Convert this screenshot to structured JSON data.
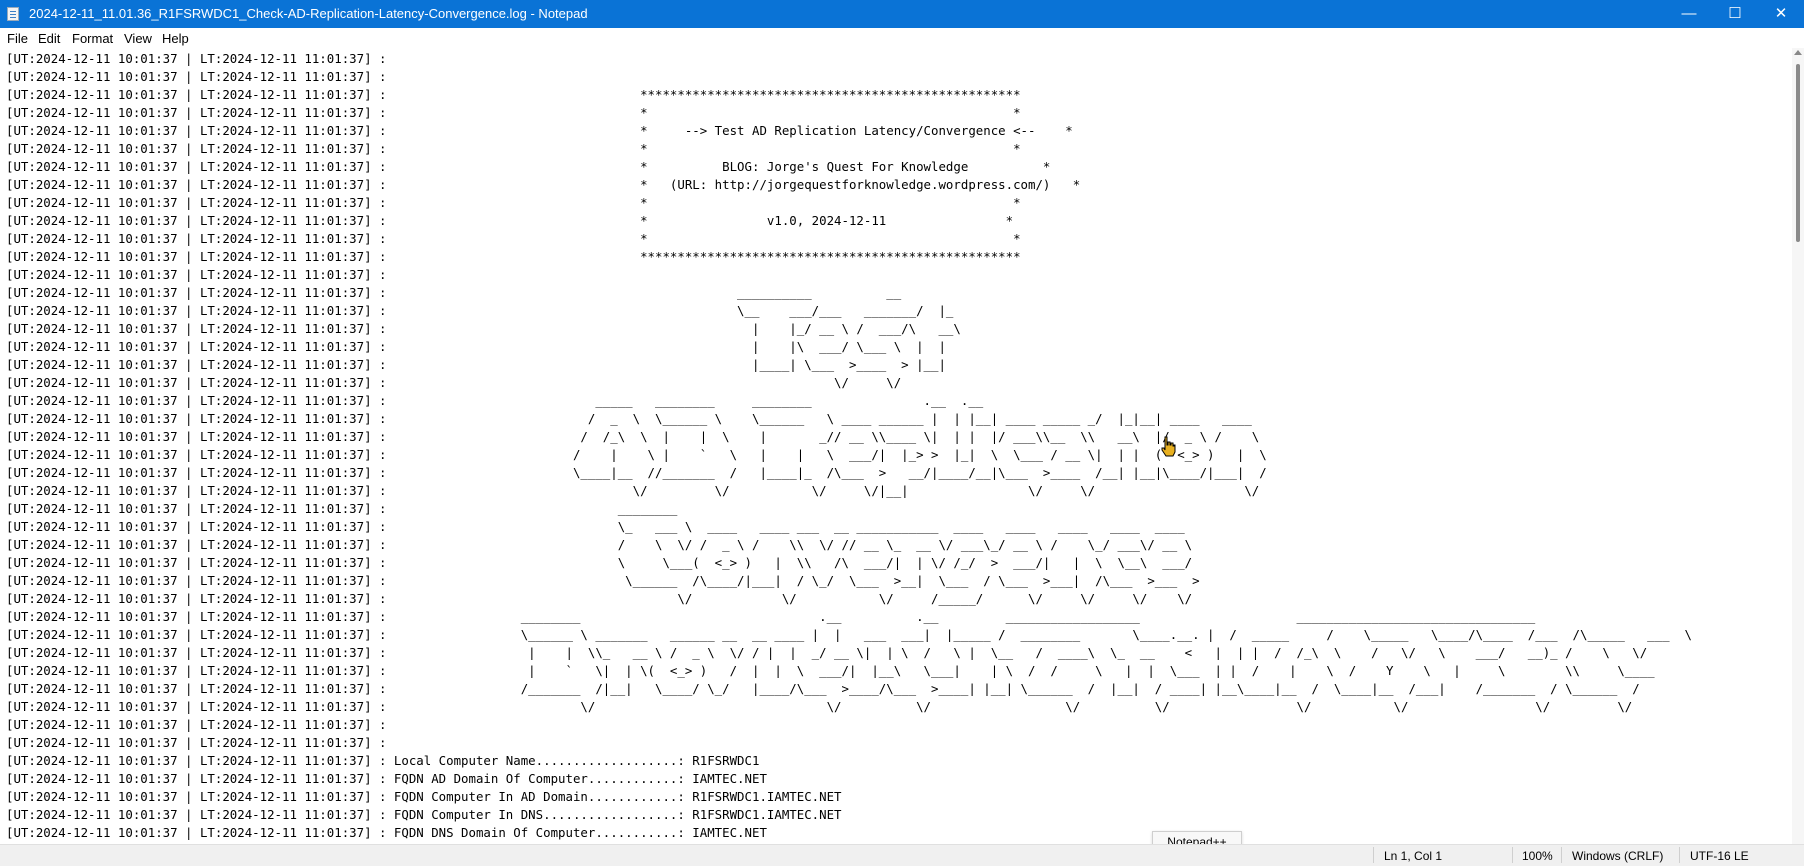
{
  "window": {
    "title": "2024-12-11_11.01.36_R1FSRWDC1_Check-AD-Replication-Latency-Convergence.log - Notepad",
    "minimize_glyph": "—",
    "maximize_glyph": "☐",
    "close_glyph": "✕"
  },
  "menu": [
    "File",
    "Edit",
    "Format",
    "View",
    "Help"
  ],
  "log": {
    "prefix": "[UT:2024-12-11 10:01:37 | LT:2024-12-11 11:01:37] : ",
    "lines": [
      "",
      "",
      "                                 ***************************************************",
      "                                 *                                                 *",
      "                                 *     --> Test AD Replication Latency/Convergence <--    *",
      "                                 *                                                 *",
      "                                 *          BLOG: Jorge's Quest For Knowledge          *",
      "                                 *   (URL: http://jorgequestforknowledge.wordpress.com/)   *",
      "                                 *                                                 *",
      "                                 *                v1.0, 2024-12-11                *",
      "                                 *                                                 *",
      "                                 ***************************************************",
      "",
      "                                              __________          __",
      "                                              \\__    ___/___   _______/  |_",
      "                                                |    |_/ __ \\ /  ___/\\   __\\",
      "                                                |    |\\  ___/ \\___ \\  |  |",
      "                                                |____| \\___  >____  > |__|",
      "                                                           \\/     \\/",
      "                           _____   ________     ________               .__  .__",
      "                          /  _  \\  \\______ \\    \\______   \\ ____ ______ |  | |__| ____ _____ _/  |_|__| ____   ____",
      "                         /  /_\\  \\  |    |  \\    |       _// __ \\\\____ \\|  | |  |/ ___\\\\__  \\\\   __\\  |/  _ \\ /    \\",
      "                        /    |    \\ |    `   \\   |    |   \\  ___/|  |_> >  |_|  \\  \\___ / __ \\|  | |  (  <_> )   |  \\",
      "                        \\____|__  //_______  /   |____|_  /\\___  >   __/|____/__|\\___  >____  /__| |__|\\____/|___|  /",
      "                                \\/         \\/           \\/     \\/|__|                \\/     \\/                    \\/",
      "                              ________",
      "                              \\_   ___ \\  ____   ____ ___  __ ___________  ____   ____   ____   ____  ____",
      "                              /    \\  \\/ /  _ \\ /    \\\\  \\/ // __ \\_  __ \\/ ___\\_/ __ \\ /    \\_/ ___\\/ __ \\",
      "                              \\     \\___(  <_> )   |  \\\\   /\\  ___/|  | \\/ /_/  >  ___/|   |  \\  \\__\\  ___/",
      "                               \\______  /\\____/|___|  / \\_/  \\___  >__|  \\___  / \\___  >___|  /\\___  >___  >",
      "                                      \\/            \\/           \\/     /_____/      \\/     \\/     \\/    \\/",
      "                 ________                                .__          .__         __________________                     ________________________________",
      "                 \\______ \\ _______   ______ __  __ ____ |  |   ___  ___|  |_____ /  ________       \\____.__. |  /  _____     /    \\_____   \\____/\\____  /___  /\\_____   ___  \\",
      "                  |    |  \\\\_   __ \\ /  _ \\  \\/ / |  |  _/ __ \\|  | \\  /   \\ |  \\__   /  ____\\  \\_  __    <   |  | |  /  /_\\  \\    /   \\/   \\    ___/   __)_ /    \\   \\/",
      "                  |    `   \\|  | \\(  <_> )   /  |  |  \\  ___/|  |__\\   \\___|    | \\  /  /     \\   |  |  \\___  | |  /    |    \\  /    Y    \\   |     \\        \\\\     \\____",
      "                 /_______  /|__|   \\____/ \\_/   |____/\\___  >____/\\___  >____| |__| \\______  /  |__|  / ____| |__\\____|__  /  \\____|__  /___|    /_______  / \\______  /",
      "                         \\/                               \\/          \\/                  \\/          \\/                 \\/           \\/                 \\/         \\/",
      "",
      "",
      "Local Computer Name...................: R1FSRWDC1",
      "FQDN AD Domain Of Computer............: IAMTEC.NET",
      "FQDN Computer In AD Domain............: R1FSRWDC1.IAMTEC.NET",
      "FQDN Computer In DNS..................: R1FSRWDC1.IAMTEC.NET",
      "FQDN DNS Domain Of Computer...........: IAMTEC.NET"
    ]
  },
  "tooltip": "Notepad++",
  "status": {
    "position": "Ln 1, Col 1",
    "zoom": "100%",
    "line_ending": "Windows (CRLF)",
    "encoding": "UTF-16 LE"
  },
  "colors": {
    "titlebar": "#0a73d6",
    "cursor": "#e8b020"
  }
}
